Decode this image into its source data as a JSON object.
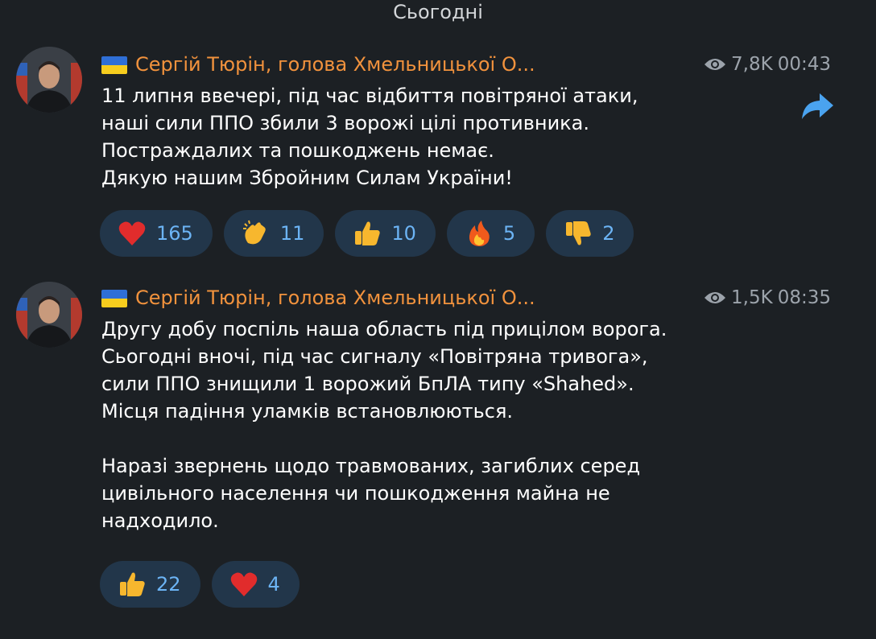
{
  "date_separator": "Сьогодні",
  "messages": [
    {
      "author": "Сергій Тюрін, голова Хмельницької О...",
      "views": "7,8K",
      "time": "00:43",
      "lines": [
        "11 липня ввечері, під час відбиття повітряної атаки,",
        "наші сили ППО збили 3 ворожі цілі противника.",
        "Постраждалих та пошкоджень немає.",
        "Дякую нашим Збройним Силам України!"
      ],
      "reactions": [
        {
          "emoji": "heart-icon",
          "count": "165"
        },
        {
          "emoji": "clap-icon",
          "count": "11"
        },
        {
          "emoji": "thumbs-up-icon",
          "count": "10"
        },
        {
          "emoji": "fire-icon",
          "count": "5"
        },
        {
          "emoji": "thumbs-down-icon",
          "count": "2"
        }
      ]
    },
    {
      "author": "Сергій Тюрін, голова Хмельницької О...",
      "views": "1,5K",
      "time": "08:35",
      "lines": [
        "Другу добу поспіль наша область під прицілом ворога.",
        "Сьогодні вночі, під час сигналу «Повітряна тривога»,",
        "сили ППО знищили 1 ворожий БпЛА типу «Shahed».",
        "Місця падіння уламків встановлюються.",
        "",
        "Наразі звернень щодо травмованих, загиблих серед",
        "цивільного населення чи пошкодження майна не",
        "надходило."
      ],
      "reactions": [
        {
          "emoji": "thumbs-up-icon",
          "count": "22"
        },
        {
          "emoji": "heart-icon",
          "count": "4"
        }
      ]
    }
  ],
  "colors": {
    "background": "#1c2024",
    "author": "#f1923d",
    "reaction_bg": "#22364a",
    "reaction_count": "#6cb4f5",
    "meta": "#9ca3ab",
    "forward": "#4aa3ef"
  }
}
